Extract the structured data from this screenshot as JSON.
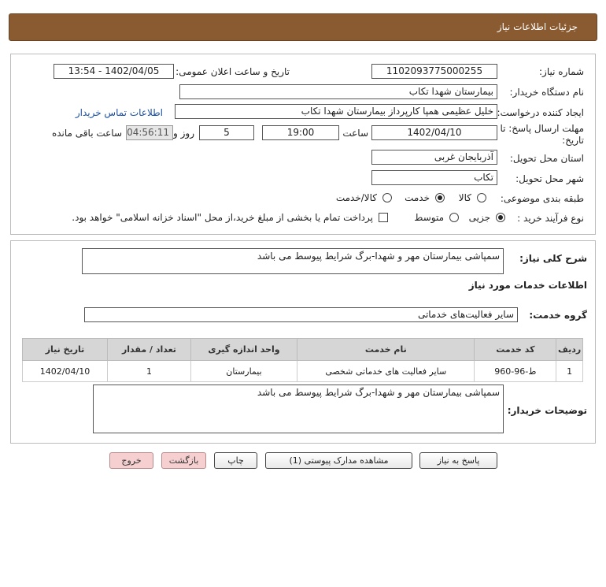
{
  "header": {
    "title": "جزئیات اطلاعات نیاز"
  },
  "fields": {
    "need_number_label": "شماره نیاز:",
    "need_number": "1102093775000255",
    "announce_label": "تاریخ و ساعت اعلان عمومی:",
    "announce_value": "1402/04/05 - 13:54",
    "buyer_org_label": "نام دستگاه خریدار:",
    "buyer_org": "بیمارستان شهدا تکاب",
    "requester_label": "ایجاد کننده درخواست:",
    "requester": "خلیل عظیمی همپا کارپرداز بیمارستان شهدا تکاب",
    "contact_link": "اطلاعات تماس خریدار",
    "deadline_label": "مهلت ارسال پاسخ: تا تاریخ:",
    "deadline_date": "1402/04/10",
    "time_label": "ساعت",
    "deadline_time": "19:00",
    "days_value": "5",
    "days_label": "روز و",
    "remaining_time": "04:56:11",
    "remaining_label": "ساعت باقی مانده",
    "province_label": "استان محل تحویل:",
    "province": "آذربایجان غربی",
    "city_label": "شهر محل تحویل:",
    "city": "تکاب",
    "category_label": "طبقه بندی موضوعی:",
    "category_options": [
      "کالا",
      "خدمت",
      "کالا/خدمت"
    ],
    "category_selected": "خدمت",
    "process_label": "نوع فرآیند خرید :",
    "process_options": [
      "جزیی",
      "متوسط"
    ],
    "process_selected": "جزیی",
    "payment_note": "پرداخت تمام یا بخشی از مبلغ خرید،از محل \"اسناد خزانه اسلامی\" خواهد بود."
  },
  "summary": {
    "label": "شرح کلی نیاز:",
    "value": "سمپاشی بیمارستان مهر و شهدا-برگ شرایط پیوسط می باشد"
  },
  "services": {
    "section_title": "اطلاعات خدمات مورد نیاز",
    "group_label": "گروه خدمت:",
    "group_value": "سایر فعالیت‌های خدماتی",
    "columns": [
      "ردیف",
      "کد خدمت",
      "نام خدمت",
      "واحد اندازه گیری",
      "تعداد / مقدار",
      "تاریخ نیاز"
    ],
    "rows": [
      [
        "1",
        "ط-96-960",
        "سایر فعالیت های خدماتی شخصی",
        "بیمارستان",
        "1",
        "1402/04/10"
      ]
    ]
  },
  "buyer_notes": {
    "label": "توضیحات خریدار:",
    "value": "سمپاشی بیمارستان مهر و شهدا-برگ شرایط پیوسط می باشد"
  },
  "buttons": {
    "reply": "پاسخ به نیاز",
    "attachments": "مشاهده مدارک پیوستی (1)",
    "print": "چاپ",
    "back": "بازگشت",
    "exit": "خروج"
  },
  "colors": {
    "header_bg": "#8a5a30",
    "link": "#1a4fa0",
    "back_exit_bg": "#f6d0d0"
  }
}
